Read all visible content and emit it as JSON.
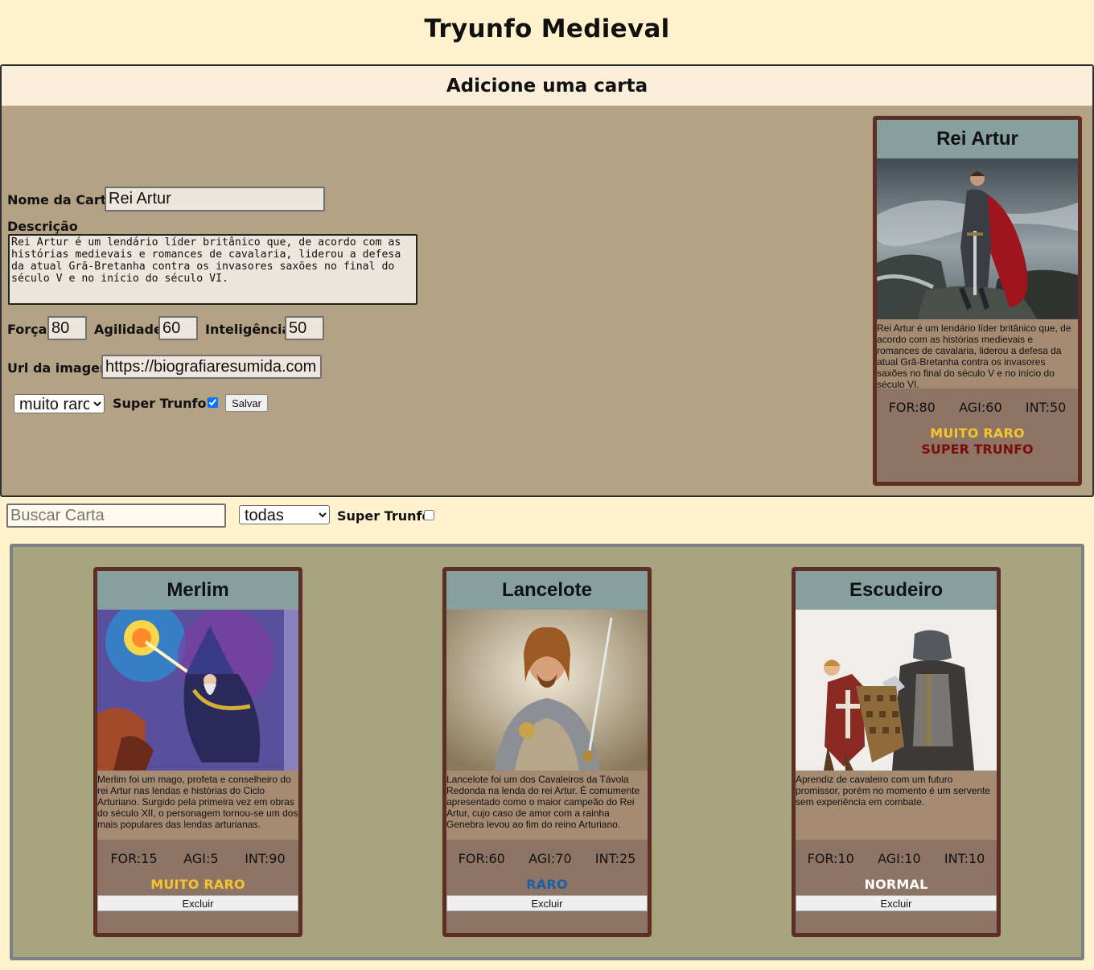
{
  "app": {
    "title": "Tryunfo Medieval"
  },
  "form": {
    "heading": "Adicione uma carta",
    "name_label": "Nome da Carta",
    "name_value": "Rei Artur",
    "description_label": "Descrição",
    "description_value": "Rei Artur é um lendário líder britânico que, de acordo com as histórias medievais e romances de cavalaria, liderou a defesa da atual Grã-Bretanha contra os invasores saxões no final do século V e no início do século VI.",
    "strength_label": "Força",
    "strength_value": "80",
    "agility_label": "Agilidade",
    "agility_value": "60",
    "intelligence_label": "Inteligência",
    "intelligence_value": "50",
    "image_label": "Url da imagem",
    "image_value": "https://biografiaresumida.com.br",
    "rarity_value": "muito raro",
    "super_label": "Super Trunfo?",
    "super_checked": true,
    "save_label": "Salvar"
  },
  "preview": {
    "name": "Rei Artur",
    "image_icon": "king-arthur-image",
    "description": "Rei Artur é um lendário líder britânico que, de acordo com as histórias medievais e romances de cavalaria, liderou a defesa da atual Grã-Bretanha contra os invasores saxões no final do século V e no início do século VI.",
    "for": "FOR:80",
    "agi": "AGI:60",
    "int": "INT:50",
    "rarity": "MUITO RARO",
    "rarity_color": "#f4c430",
    "super": "SUPER TRUNFO"
  },
  "filters": {
    "search_placeholder": "Buscar Carta",
    "rarity_value": "todas",
    "super_label": "Super Trunfo",
    "super_checked": false
  },
  "deck": {
    "cards": [
      {
        "name": "Merlim",
        "image_icon": "merlin-image",
        "description": "Merlim foi um mago, profeta e conselheiro do rei Artur nas lendas e histórias do Ciclo Arturiano. Surgido pela primeira vez em obras do século XII, o personagem tornou-se um dos mais populares das lendas arturianas.",
        "for": "FOR:15",
        "agi": "AGI:5",
        "int": "INT:90",
        "rarity": "MUITO RARO",
        "rarity_color": "#f4c430",
        "delete_label": "Excluir"
      },
      {
        "name": "Lancelote",
        "image_icon": "lancelot-image",
        "description": "Lancelote foi um dos Cavaleiros da Távola Redonda na lenda do rei Artur. É comumente apresentado como o maior campeão do Rei Artur, cujo caso de amor com a rainha Genebra levou ao fim do reino Arturiano.",
        "for": "FOR:60",
        "agi": "AGI:70",
        "int": "INT:25",
        "rarity": "RARO",
        "rarity_color": "#1c5ea8",
        "delete_label": "Excluir"
      },
      {
        "name": "Escudeiro",
        "image_icon": "squire-image",
        "description": "Aprendiz de cavaleiro com um futuro promissor, porém no momento é um servente sem experiência em combate.",
        "for": "FOR:10",
        "agi": "AGI:10",
        "int": "INT:10",
        "rarity": "NORMAL",
        "rarity_color": "#ffffff",
        "delete_label": "Excluir"
      }
    ]
  }
}
